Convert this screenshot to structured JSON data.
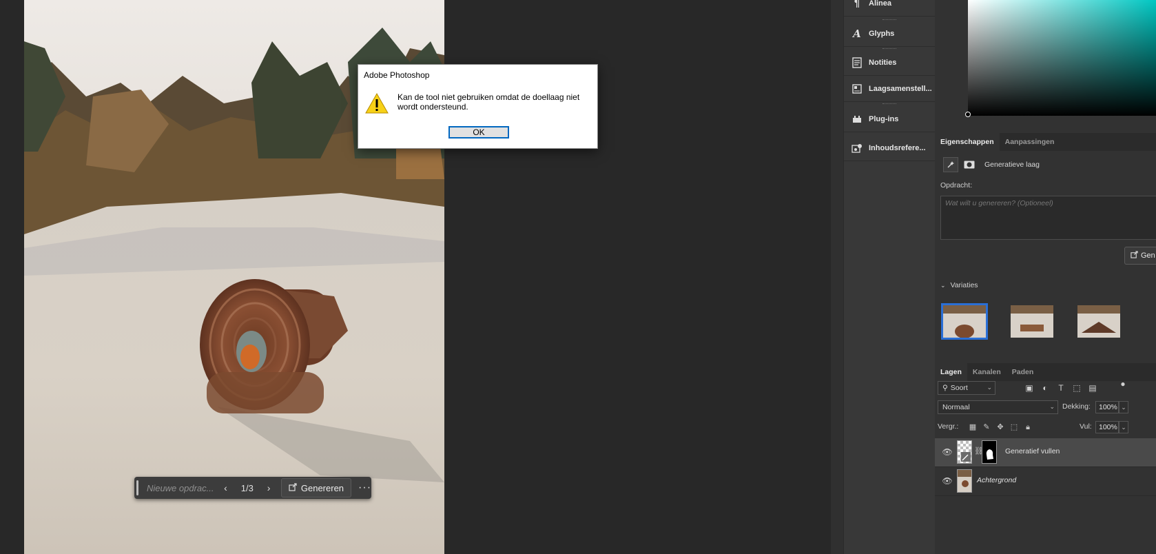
{
  "canvas": {
    "taskbar": {
      "prompt_placeholder": "Nieuwe opdrac...",
      "prev": "‹",
      "next": "›",
      "counter": "1/3",
      "generate_label": "Genereren",
      "more": "···"
    }
  },
  "dialog": {
    "title": "Adobe Photoshop",
    "message": "Kan de tool niet gebruiken omdat de doellaag niet wordt ondersteund.",
    "ok_label": "OK"
  },
  "mid_panel": {
    "items": [
      {
        "label": "Alinea",
        "icon": "paragraph-icon"
      },
      {
        "label": "Glyphs",
        "icon": "glyphs-icon"
      },
      {
        "label": "Notities",
        "icon": "notes-icon"
      },
      {
        "label": "Laagsamenstell...",
        "icon": "layer-comps-icon"
      },
      {
        "label": "Plug-ins",
        "icon": "plugins-icon"
      },
      {
        "label": "Inhoudsrefere...",
        "icon": "content-credentials-icon"
      }
    ]
  },
  "properties": {
    "tabs": [
      "Eigenschappen",
      "Aanpassingen"
    ],
    "layer_type": "Generatieve laag",
    "prompt_label": "Opdracht:",
    "prompt_placeholder": "Wat wilt u genereren?  (Optioneel)",
    "generate_label": "Gen",
    "variations_label": "Variaties",
    "selected_variation": 1
  },
  "layers": {
    "tabs": [
      "Lagen",
      "Kanalen",
      "Paden"
    ],
    "filter_label": "Soort",
    "blend_mode": "Normaal",
    "opacity_label": "Dekking:",
    "opacity": "100%",
    "lock_label": "Vergr.:",
    "fill_label": "Vul:",
    "fill": "100%",
    "items": [
      {
        "name": "Generatief vullen",
        "selected": true
      },
      {
        "name": "Achtergrond",
        "selected": false
      }
    ]
  },
  "colors": {
    "accent": "#2a6fd6",
    "panel_bg": "#323232",
    "workspace_bg": "#282828"
  }
}
